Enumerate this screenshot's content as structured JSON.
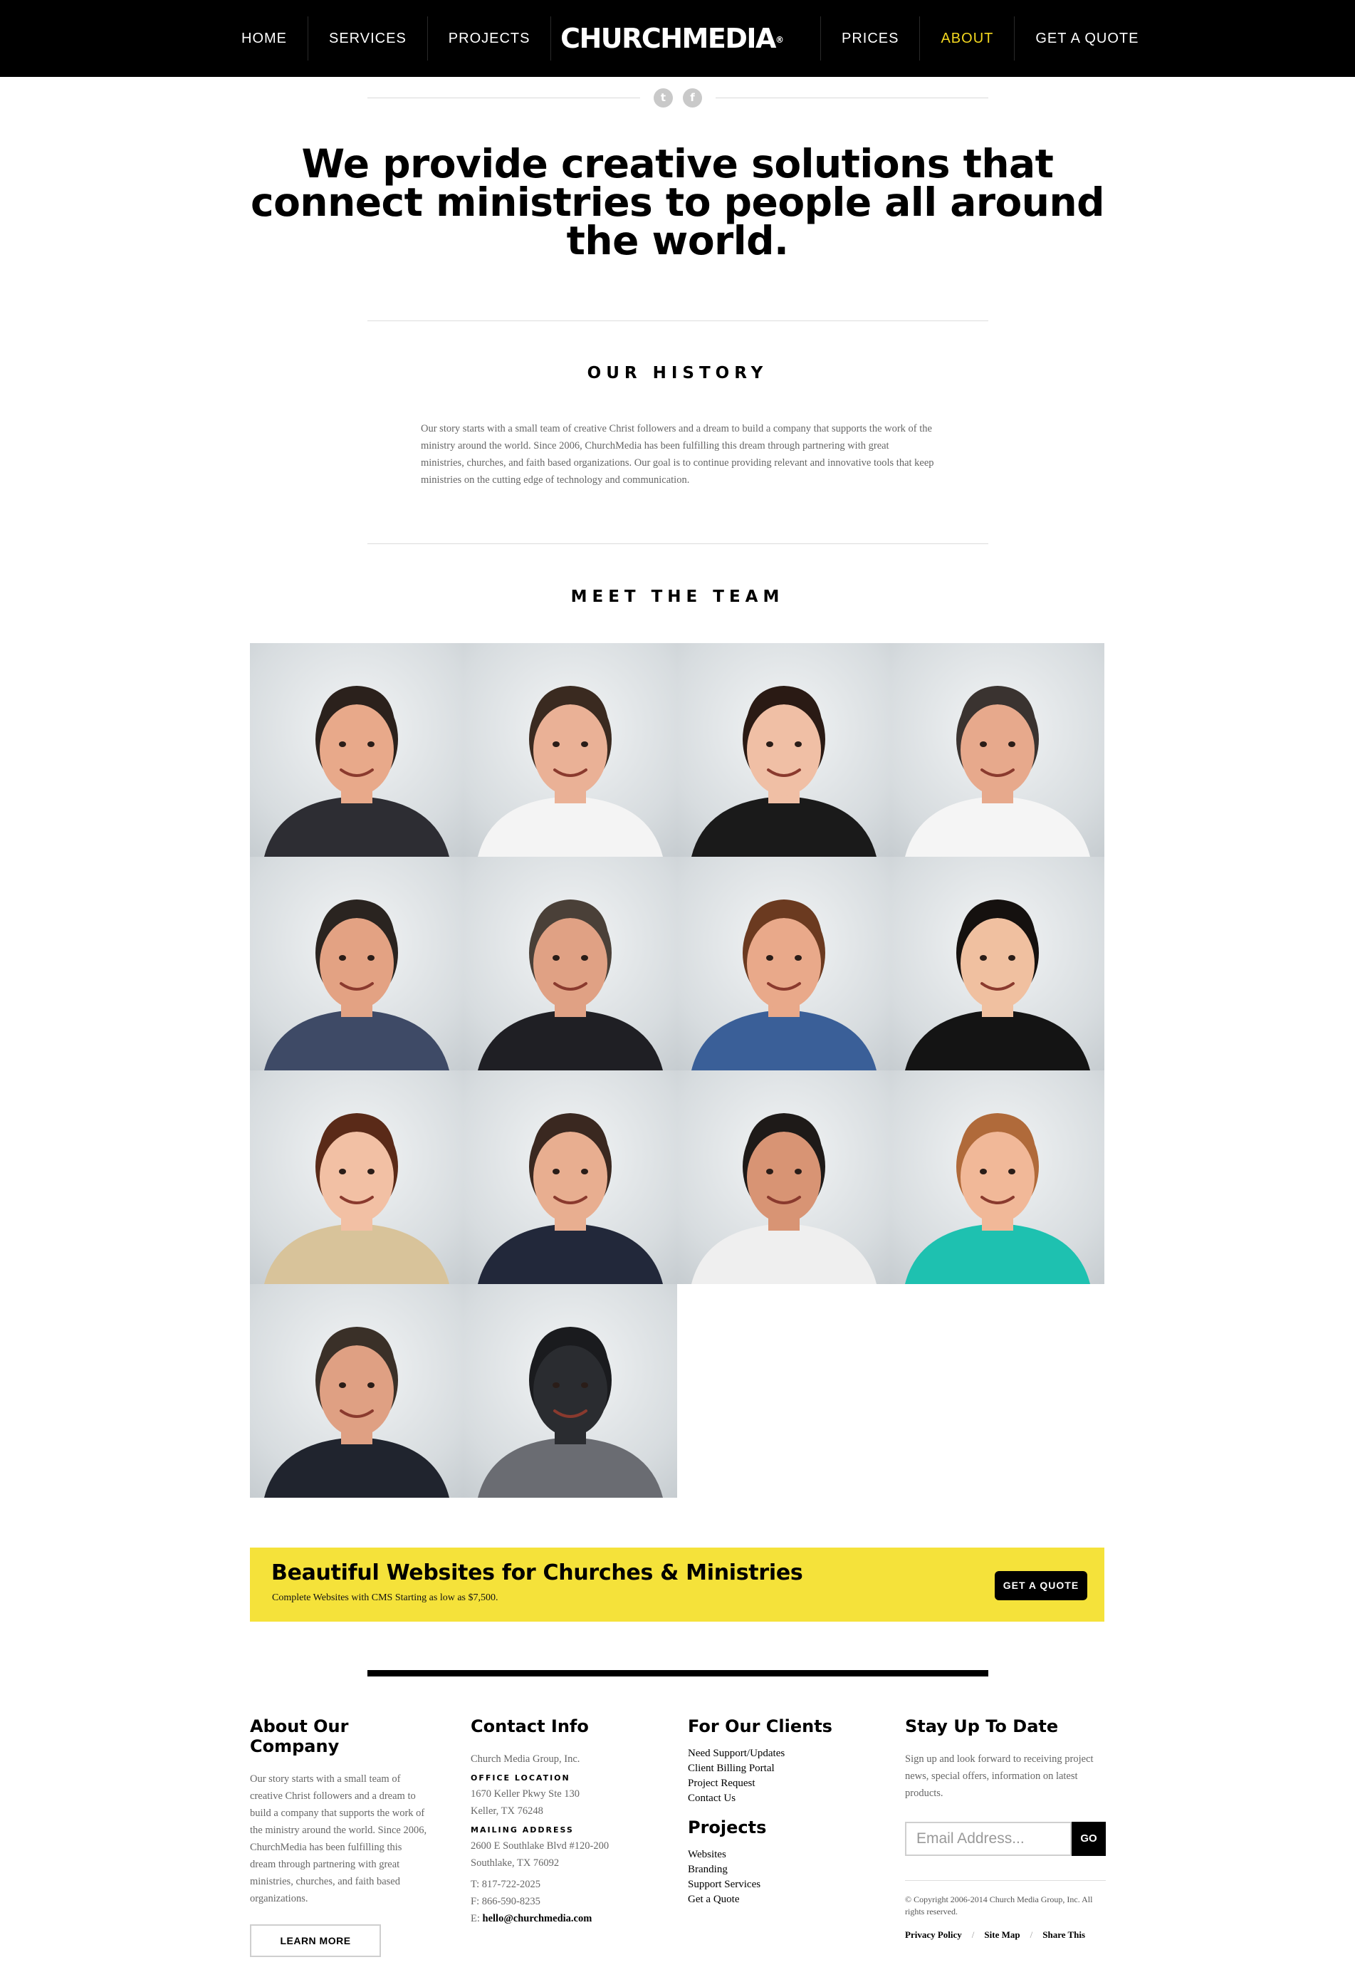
{
  "nav": {
    "left": [
      "HOME",
      "SERVICES",
      "PROJECTS"
    ],
    "right": [
      "PRICES",
      "ABOUT",
      "GET A QUOTE"
    ],
    "active": "ABOUT"
  },
  "logo": {
    "text": "CHURCHMEDIA",
    "mark": "®"
  },
  "share": {
    "twitter_icon": "twitter-icon",
    "facebook_icon": "facebook-icon",
    "twitter_glyph": "t",
    "facebook_glyph": "f"
  },
  "hero": {
    "heading": "We provide creative solutions that connect ministries to people all around the world."
  },
  "history": {
    "title": "OUR HISTORY",
    "body": "Our story starts with a small team of creative Christ followers and a dream to build a company that supports the work of the ministry around the world. Since 2006, ChurchMedia has been fulfilling this dream through partnering with great ministries, churches, and faith based organizations. Our goal is to continue providing relevant and innovative tools that keep ministries on the cutting edge of technology and communication."
  },
  "team": {
    "title": "MEET THE TEAM",
    "members": [
      {
        "skin": "#e8a98a",
        "hair": "#2b211c",
        "shirt": "#2d2d33"
      },
      {
        "skin": "#eab196",
        "hair": "#3a2a20",
        "shirt": "#f4f4f4"
      },
      {
        "skin": "#f0bfa5",
        "hair": "#2a1a14",
        "shirt": "#1a1a1a"
      },
      {
        "skin": "#e7a98c",
        "hair": "#3a3330",
        "shirt": "#f5f5f5"
      },
      {
        "skin": "#e3a283",
        "hair": "#2a2420",
        "shirt": "#3e4a66"
      },
      {
        "skin": "#e0a184",
        "hair": "#4a4038",
        "shirt": "#1f1f24"
      },
      {
        "skin": "#e9a98a",
        "hair": "#6b3a20",
        "shirt": "#3a5f98"
      },
      {
        "skin": "#f0c0a0",
        "hair": "#15110f",
        "shirt": "#141414"
      },
      {
        "skin": "#f2c0a4",
        "hair": "#5a2a18",
        "shirt": "#d8c39a"
      },
      {
        "skin": "#e8ae90",
        "hair": "#3a2820",
        "shirt": "#22283a"
      },
      {
        "skin": "#d89474",
        "hair": "#1e1a18",
        "shirt": "#efefef"
      },
      {
        "skin": "#f1b898",
        "hair": "#b06a3a",
        "shirt": "#1ec1b0"
      },
      {
        "skin": "#dfa083",
        "hair": "#3a3028",
        "shirt": "#20242e"
      },
      {
        "skin": "#2a2c30",
        "hair": "#1a1b1e",
        "shirt": "#6a6c72"
      }
    ]
  },
  "banner": {
    "title": "Beautiful Websites for Churches & Ministries",
    "subtitle": "Complete Websites with CMS Starting as low as $7,500.",
    "button": "GET A QUOTE",
    "bg": "#f5e23a"
  },
  "footer": {
    "about": {
      "title": "About Our Company",
      "text": "Our story starts with a small team of creative Christ followers and a dream to build a company that supports the work of the ministry around the world. Since 2006, ChurchMedia has been fulfilling this dream through partnering with great ministries, churches, and faith based organizations.",
      "button": "LEARN MORE"
    },
    "contact": {
      "title": "Contact Info",
      "company": "Church Media Group, Inc.",
      "office_label": "OFFICE LOCATION",
      "office_line1": "1670 Keller Pkwy Ste 130",
      "office_line2": "Keller, TX 76248",
      "mailing_label": "MAILING ADDRESS",
      "mailing_line1": "2600 E Southlake Blvd #120-200",
      "mailing_line2": "Southlake, TX 76092",
      "phone": "T: 817-722-2025",
      "fax": "F: 866-590-8235",
      "email_prefix": "E: ",
      "email": "hello@churchmedia.com"
    },
    "clients": {
      "title": "For Our Clients",
      "links": [
        "Need Support/Updates",
        "Client Billing Portal",
        "Project Request",
        "Contact Us"
      ]
    },
    "projects": {
      "title": "Projects",
      "links": [
        "Websites",
        "Branding",
        "Support Services",
        "Get a Quote"
      ]
    },
    "newsletter": {
      "title": "Stay Up To Date",
      "text": "Sign up and look forward to receiving project news, special offers, information on latest products.",
      "placeholder": "Email Address...",
      "button": "GO",
      "copyright": "© Copyright 2006-2014 Church Media Group, Inc. All rights reserved.",
      "legal": [
        "Privacy Policy",
        "Site Map",
        "Share This"
      ]
    }
  },
  "colors": {
    "accent": "#f4d81f",
    "banner": "#f5e23a",
    "nav_bg": "#000000"
  }
}
